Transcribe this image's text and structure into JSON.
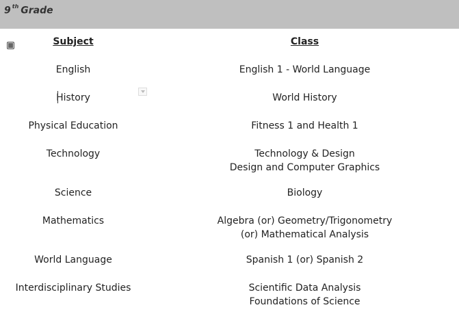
{
  "header": {
    "grade_number": "9",
    "grade_suffix": "th",
    "grade_word": "Grade"
  },
  "table": {
    "columns": {
      "subject": "Subject",
      "class": "Class"
    },
    "rows": [
      {
        "subject": "English",
        "class": [
          "English 1 - World Language"
        ]
      },
      {
        "subject": "History",
        "class": [
          "World History"
        ]
      },
      {
        "subject": "Physical Education",
        "class": [
          "Fitness 1 and Health 1"
        ]
      },
      {
        "subject": "Technology",
        "class": [
          "Technology & Design",
          "Design and Computer Graphics"
        ]
      },
      {
        "subject": "Science",
        "class": [
          "Biology"
        ]
      },
      {
        "subject": "Mathematics",
        "class": [
          "Algebra (or) Geometry/Trigonometry",
          "(or) Mathematical Analysis"
        ]
      },
      {
        "subject": "World Language",
        "class": [
          "Spanish 1 (or) Spanish 2"
        ]
      },
      {
        "subject": "Interdisciplinary Studies",
        "class": [
          "Scientific Data Analysis",
          "Foundations of Science"
        ]
      }
    ]
  },
  "icons": {
    "table_handle": "table-select-handle-icon",
    "dropdown": "dropdown-arrow-icon"
  }
}
